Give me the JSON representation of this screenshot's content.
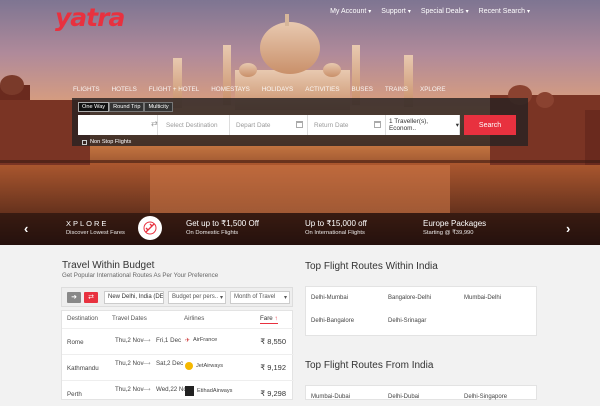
{
  "brand": {
    "logo": "yatra",
    "accent": "#e8313f"
  },
  "topnav": [
    "My Account",
    "Support",
    "Special Deals",
    "Recent Search"
  ],
  "tabs": [
    "Flights",
    "Hotels",
    "Flight + Hotel",
    "Homestays",
    "Holidays",
    "Activities",
    "Buses",
    "Trains",
    "Xplore"
  ],
  "search": {
    "trip_types": [
      "One Way",
      "Round Trip",
      "Multicity"
    ],
    "origin": "",
    "destination_placeholder": "Select Destination",
    "depart_placeholder": "Depart Date",
    "return_placeholder": "Return Date",
    "travellers": "1 Traveller(s), Econom..",
    "search_label": "Search",
    "nonstop_label": "Non Stop Flights"
  },
  "promos": [
    {
      "title": "XPLORE",
      "sub": "Discover Lowest Fares"
    },
    {
      "title": "Get up to ₹1,500 Off",
      "sub": "On Domestic Flights"
    },
    {
      "title": "Up to ₹15,000 off",
      "sub": "On International Flights"
    },
    {
      "title": "Europe Packages",
      "sub": "Starting @ ₹39,990"
    }
  ],
  "budget": {
    "title": "Travel Within Budget",
    "subtitle": "Get Popular International Routes As Per Your Preference",
    "from": "New Delhi, India (DEL)",
    "budget_placeholder": "Budget per pers..",
    "month_placeholder": "Month of Travel",
    "headers": [
      "Destination",
      "Travel Dates",
      "Airlines",
      "Fare"
    ],
    "rows": [
      {
        "dest": "Rome",
        "out": "Thu,2 Nov",
        "back": "Fri,1 Dec",
        "airline": "AirFrance",
        "fare": "₹ 8,550"
      },
      {
        "dest": "Kathmandu",
        "out": "Thu,2 Nov",
        "back": "Sat,2 Dec",
        "airline": "JetAirways",
        "fare": "₹ 9,192"
      },
      {
        "dest": "Perth",
        "out": "Thu,2 Nov",
        "back": "Wed,22 Nov",
        "airline": "EtihadAirways",
        "fare": "₹ 9,298"
      }
    ]
  },
  "within_india": {
    "title": "Top Flight Routes Within India",
    "routes": [
      "Delhi-Mumbai",
      "Bangalore-Delhi",
      "Mumbai-Delhi",
      "Delhi-Bangalore",
      "Delhi-Srinagar"
    ]
  },
  "from_india": {
    "title": "Top Flight Routes From India",
    "routes": [
      "Mumbai-Dubai",
      "Delhi-Dubai",
      "Delhi-Singapore"
    ]
  }
}
